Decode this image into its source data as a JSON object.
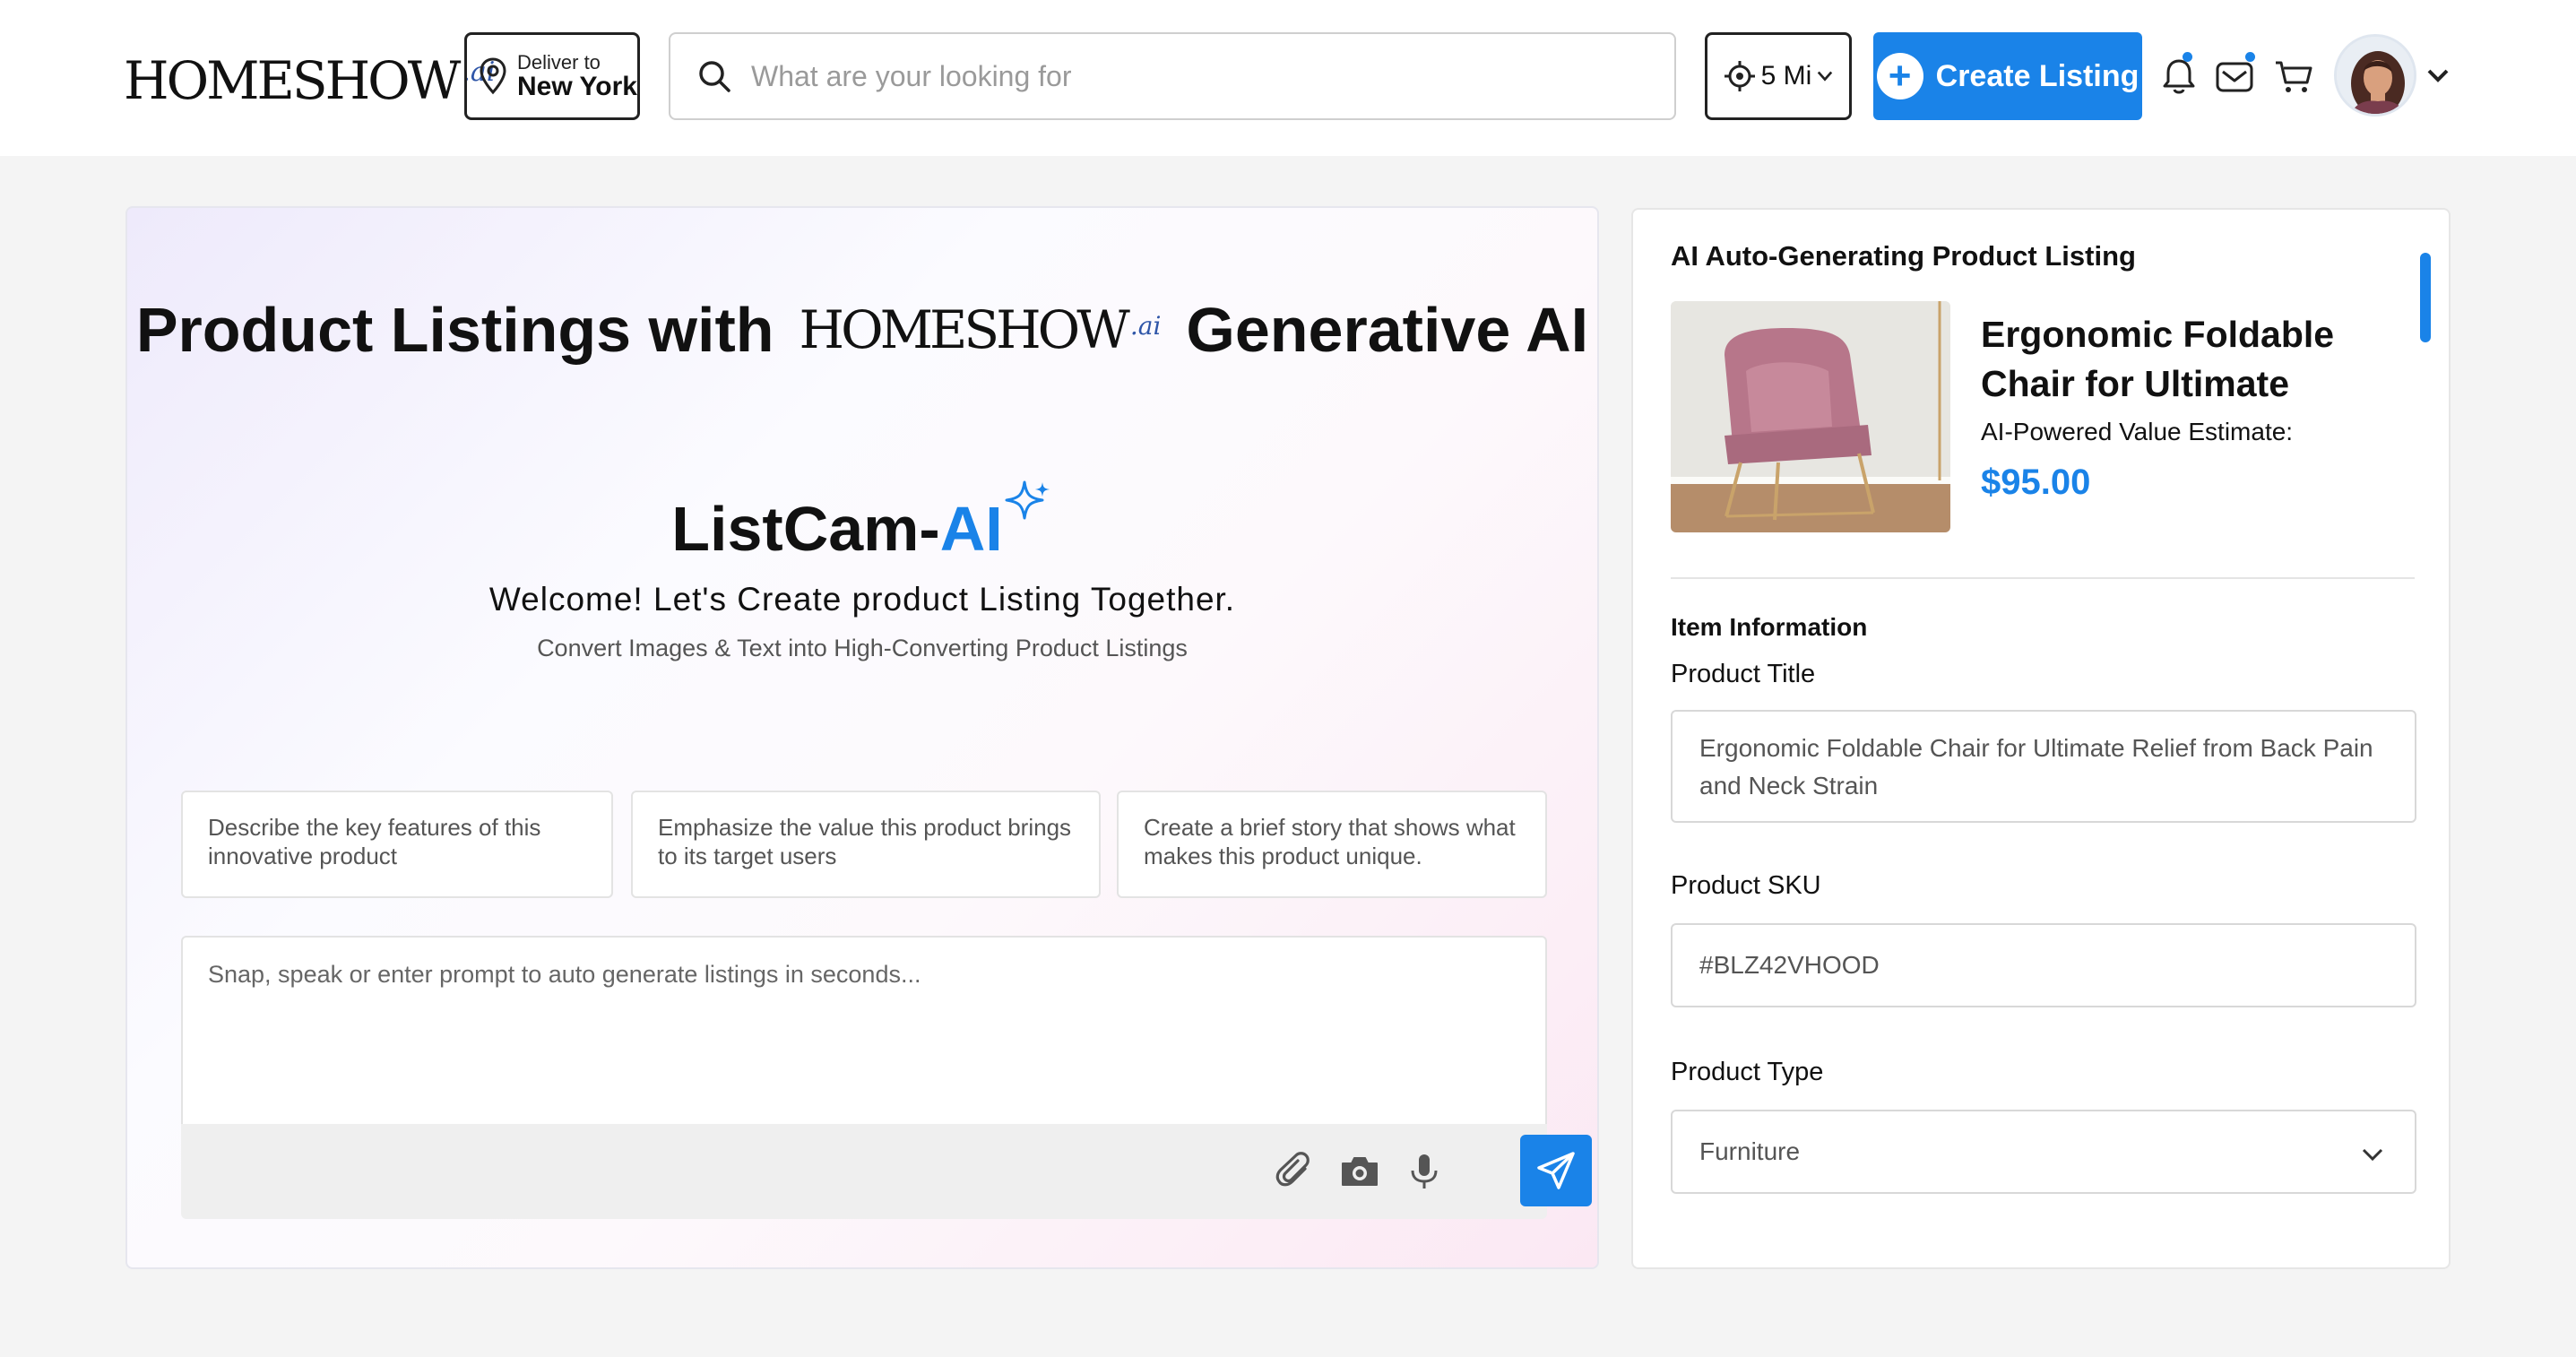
{
  "header": {
    "logo": {
      "brand": "HOMESHOW",
      "suffix": ".ai"
    },
    "deliver": {
      "label": "Deliver to",
      "location": "New York"
    },
    "search": {
      "placeholder": "What are your looking for"
    },
    "radius": {
      "value": "5 Mi"
    },
    "create_button": {
      "label": "Create Listing"
    },
    "icons": [
      "bell-icon",
      "mail-icon",
      "cart-icon",
      "chevron-down-icon"
    ],
    "accent_color": "#1a83e8"
  },
  "hero": {
    "title_before": "Product Listings with",
    "title_logo": {
      "brand": "HOMESHOW",
      "suffix": ".ai"
    },
    "title_after": "Generative AI",
    "app_name_prefix": "ListCam-",
    "app_name_ai": "AI",
    "welcome": "Welcome! Let's Create product Listing Together.",
    "subtitle": "Convert Images & Text into High-Converting Product Listings",
    "suggestions": [
      "Describe the key features of this innovative product",
      "Emphasize the value this product brings to its target users",
      "Create a brief story that shows what makes this product unique."
    ],
    "prompt_placeholder": "Snap, speak or enter prompt to auto generate listings in seconds...",
    "tool_icons": [
      "paperclip-icon",
      "camera-icon",
      "microphone-icon",
      "send-icon"
    ]
  },
  "panel": {
    "title": "AI Auto-Generating Product Listing",
    "product_name": "Ergonomic Foldable Chair for Ultimate",
    "estimate_label": "AI-Powered Value Estimate:",
    "price": "$95.00",
    "section_title": "Item Information",
    "fields": {
      "title_label": "Product Title",
      "title_value": "Ergonomic Foldable Chair for Ultimate Relief from Back Pain and Neck Strain",
      "sku_label": "Product SKU",
      "sku_value": "#BLZ42VHOOD",
      "type_label": "Product Type",
      "type_value": "Furniture"
    }
  }
}
